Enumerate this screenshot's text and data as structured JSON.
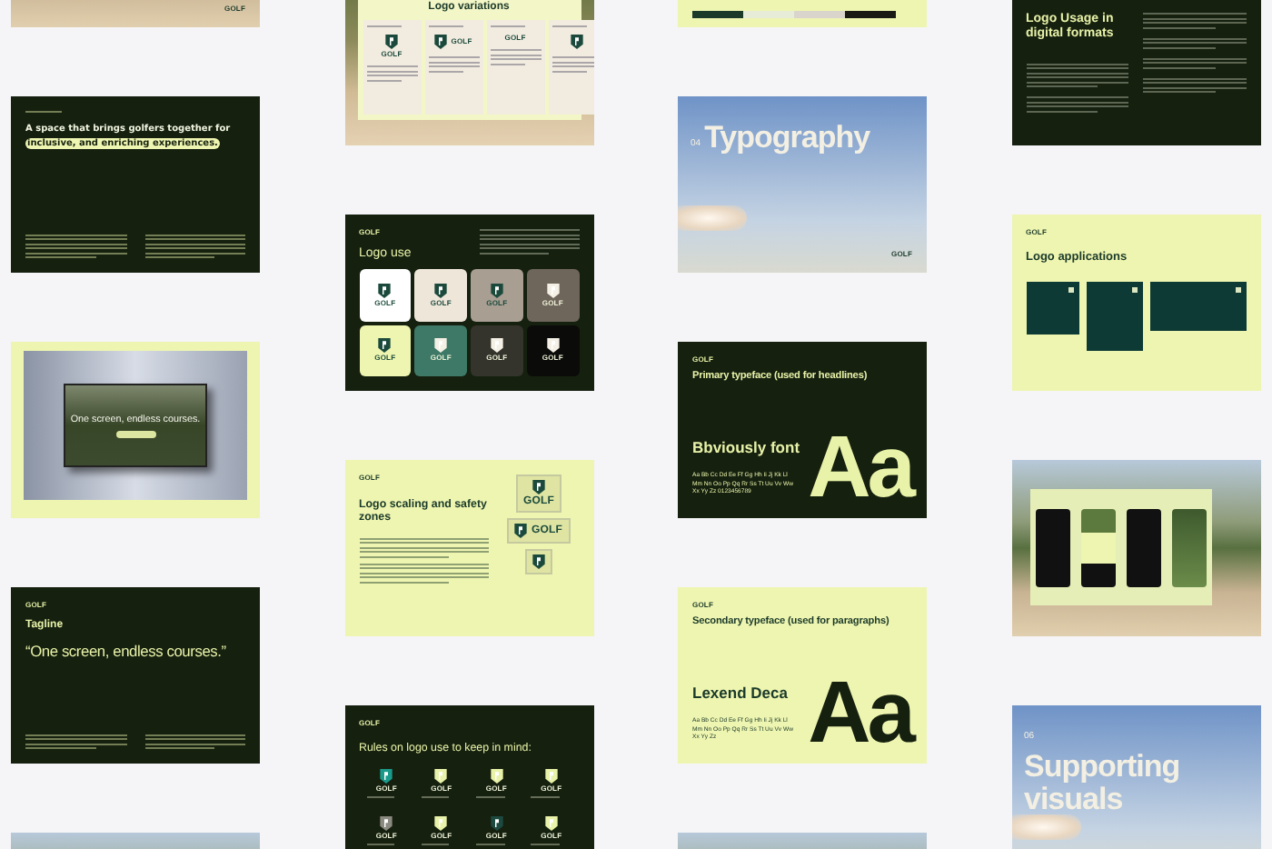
{
  "columns": [
    {
      "slides": [
        {
          "kind": "photo",
          "logo": "GOLF"
        },
        {
          "kind": "intro",
          "dark": true,
          "title": "A space that brings golfers together for",
          "highlight": "inclusive, and enriching experiences."
        },
        {
          "kind": "billboard",
          "dark": false,
          "screen_text": "One screen, endless courses."
        },
        {
          "kind": "tagline",
          "dark": true,
          "logo": "GOLF",
          "label": "Tagline",
          "quote": "“One screen, endless courses.”"
        },
        {
          "kind": "photo"
        }
      ]
    },
    {
      "slides": [
        {
          "kind": "variations",
          "title": "Logo variations",
          "cards": [
            {
              "kind": "stacked",
              "wordmark": "GOLF"
            },
            {
              "kind": "inline",
              "wordmark": "GOLF"
            },
            {
              "kind": "text",
              "wordmark": "GOLF"
            },
            {
              "kind": "icon"
            }
          ]
        },
        {
          "kind": "logo_use",
          "dark": true,
          "logo": "GOLF",
          "title": "Logo use",
          "swatches": [
            {
              "color": "#ffffff",
              "wordmark": "GOLF"
            },
            {
              "color": "#efe6da",
              "wordmark": "GOLF"
            },
            {
              "color": "#a89e92",
              "wordmark": "GOLF"
            },
            {
              "color": "#6e655b",
              "wordmark": "GOLF"
            },
            {
              "color": "#eef5b0",
              "wordmark": "GOLF"
            },
            {
              "color": "#3e7866",
              "wordmark": "GOLF"
            },
            {
              "color": "#34342c",
              "wordmark": "GOLF"
            },
            {
              "color": "#0b0b09",
              "wordmark": "GOLF"
            }
          ]
        },
        {
          "kind": "scaling",
          "dark": false,
          "logo": "GOLF",
          "title": "Logo scaling and safety zones",
          "samples": [
            {
              "kind": "stacked",
              "wordmark": "GOLF"
            },
            {
              "kind": "inline",
              "wordmark": "GOLF"
            },
            {
              "kind": "icon"
            }
          ]
        },
        {
          "kind": "rules",
          "dark": true,
          "logo": "GOLF",
          "title": "Rules on logo use to keep in mind:",
          "examples": [
            {
              "color": "#1a9a8a",
              "wordmark": "GOLF"
            },
            {
              "color": "#e8f2a8",
              "wordmark": "GOLF"
            },
            {
              "color": "#e8f2a8",
              "wordmark": "GOLF"
            },
            {
              "color": "#e8f2a8",
              "wordmark": "GOLF"
            },
            {
              "color": "#8a8a80",
              "wordmark": "GOLF"
            },
            {
              "color": "#e8f2a8",
              "wordmark": "GOLF"
            },
            {
              "color": "#1d4a40",
              "wordmark": "GOLF"
            },
            {
              "color": "#e8f2a8",
              "wordmark": "GOLF"
            }
          ]
        }
      ]
    },
    {
      "slides": [
        {
          "kind": "strip",
          "dark": false
        },
        {
          "kind": "section",
          "number": "04",
          "title": "Typography",
          "logo": "GOLF"
        },
        {
          "kind": "typeface",
          "dark": true,
          "logo": "GOLF",
          "heading": "Primary typeface (used for headlines)",
          "font_name": "Bbviously font",
          "alphabet": "Aa Bb Cc Dd Ee Ff Gg Hh Ii Jj Kk Ll Mm Nn Oo Pp Qq Rr Ss Tt Uu Vv Ww Xx Yy Zz 0123456789",
          "sample": "Aa"
        },
        {
          "kind": "typeface",
          "dark": false,
          "logo": "GOLF",
          "heading": "Secondary typeface (used for paragraphs)",
          "font_name": "Lexend Deca",
          "alphabet": "Aa Bb Cc Dd Ee Ff Gg Hh Ii Jj Kk Ll Mm Nn Oo Pp Qq Rr Ss Tt Uu Vv Ww Xx Yy Zz",
          "sample": "Aa"
        },
        {
          "kind": "photo"
        }
      ]
    },
    {
      "slides": [
        {
          "kind": "digital",
          "dark": true,
          "title": "Logo Usage in digital formats"
        },
        {
          "kind": "applications",
          "dark": false,
          "logo": "GOLF",
          "title": "Logo applications"
        },
        {
          "kind": "mockup"
        },
        {
          "kind": "section",
          "number": "06",
          "title": "Supporting visuals"
        }
      ]
    }
  ]
}
